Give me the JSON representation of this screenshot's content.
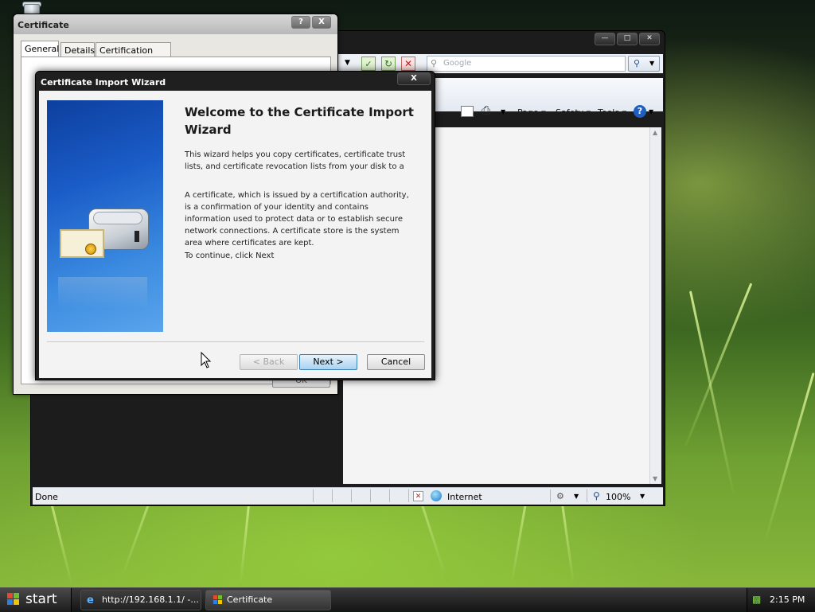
{
  "desktop": {
    "recycle_icon": "recycle-bin-icon"
  },
  "browser": {
    "search_placeholder": "Google",
    "cmd": {
      "page": "Page",
      "safety": "Safety",
      "tools": "Tools"
    },
    "status": {
      "text": "Done",
      "zone": "Internet",
      "zoom": "100%"
    }
  },
  "certificate": {
    "title": "Certificate",
    "help_btn": "?",
    "close_btn": "X",
    "tabs": [
      "General",
      "Details",
      "Certification Path"
    ],
    "hidden_ok": "OK"
  },
  "wizard": {
    "title": "Certificate Import Wizard",
    "close_btn": "X",
    "heading": "Welcome to the Certificate Import Wizard",
    "para1": "This wizard helps you copy certificates, certificate trust lists, and certificate revocation lists from your disk to a certificate store.",
    "para2": "A certificate, which is issued by a certification authority, is a confirmation of your identity and contains information used to protect data or to establish secure network connections. A certificate store is the system area where certificates are kept.",
    "para3": "To continue, click Next",
    "back": "< Back",
    "next": "Next >",
    "cancel": "Cancel"
  },
  "taskbar": {
    "start": "start",
    "tasks": [
      "http://192.168.1.1/ -...",
      "Certificate"
    ],
    "clock": "2:15 PM"
  }
}
